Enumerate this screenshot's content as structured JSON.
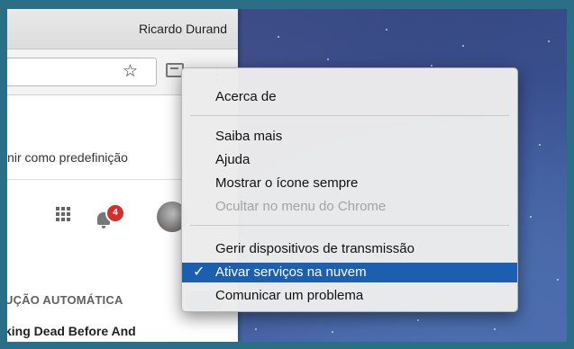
{
  "browser": {
    "profile_name": "Ricardo Durand",
    "bookmark_hint": "inir como predefinição",
    "notification_count": "4",
    "section_label": "UÇÃO AUTOMÁTICA",
    "article_title": "king Dead Before And"
  },
  "icons": {
    "bookmark_star": "☆",
    "menu_dots": "⋮"
  },
  "context_menu": {
    "items": [
      {
        "label": "Acerca de"
      },
      {
        "label": "Saiba mais"
      },
      {
        "label": "Ajuda"
      },
      {
        "label": "Mostrar o ícone sempre"
      },
      {
        "label": "Ocultar no menu do Chrome",
        "disabled": true
      },
      {
        "label": "Gerir dispositivos de transmissão"
      },
      {
        "label": "Ativar serviços na nuvem",
        "checked": true,
        "highlighted": true
      },
      {
        "label": "Comunicar um problema"
      }
    ],
    "check_glyph": "✓"
  },
  "colors": {
    "highlight": "#1c5fb0",
    "badge": "#d32f2f",
    "toggle": "#1a73b8"
  }
}
